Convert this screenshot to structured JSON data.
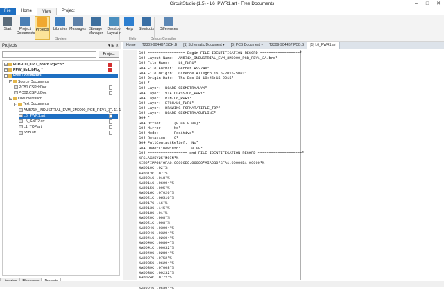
{
  "window": {
    "title": "CircuitStudio (1.5) - L6_PWR1.art - Free Documents"
  },
  "ribbon_tabs": [
    "File",
    "Home",
    "View",
    "Project"
  ],
  "ribbon_buttons": [
    {
      "label": "Start",
      "icon": "start-icon"
    },
    {
      "label": "Project\nDocuments",
      "icon": "project-documents-icon"
    },
    {
      "label": "Projects",
      "icon": "projects-icon"
    },
    {
      "label": "Libraries",
      "icon": "libraries-icon"
    },
    {
      "label": "Messages",
      "icon": "messages-icon"
    },
    {
      "label": "Storage\nManager",
      "icon": "storage-manager-icon"
    },
    {
      "label": "Desktop\nLayout ▾",
      "icon": "desktop-layout-icon"
    },
    {
      "label": "Help",
      "icon": "help-icon"
    },
    {
      "label": "Shortcuts",
      "icon": "shortcuts-icon"
    },
    {
      "label": "Differences",
      "icon": "differences-icon"
    }
  ],
  "ribbon_groups": {
    "system": "System",
    "help": "Help",
    "design_compiler": "Design Compiler"
  },
  "projects_panel": {
    "title": "Projects",
    "controls": "▾ ⊞ ✕",
    "project_button": "Project",
    "tree": [
      {
        "label": "FCP-100_CPU_board.PrjPcb *",
        "level": 0,
        "exp": "+",
        "bold": true,
        "pdf": true
      },
      {
        "label": "PFW_lib.LibPkg *",
        "level": 0,
        "exp": "+",
        "bold": true,
        "pdf": true
      },
      {
        "label": "Free Documents",
        "level": 0,
        "exp": "−",
        "bold": true,
        "selected": true
      },
      {
        "label": "Source Documents",
        "level": 1,
        "exp": "−"
      },
      {
        "label": "PCB1.CSPcbDoc",
        "level": 2,
        "doc": true
      },
      {
        "label": "PCB2.CSPcbDoc",
        "level": 2,
        "doc": true
      },
      {
        "label": "Documentation",
        "level": 1,
        "exp": "−"
      },
      {
        "label": "Text Documents",
        "level": 2,
        "exp": "−"
      },
      {
        "label": "AM571X_INDUSTRIAL_EVM_3M0000_PCB_REV1_3A-11-1",
        "level": 3,
        "doc": true
      },
      {
        "label": "L6_PWR1.art",
        "level": 3,
        "doc": true,
        "selected": true
      },
      {
        "label": "L5_GND2.art",
        "level": 3,
        "doc": true
      },
      {
        "label": "L1_TOP.art",
        "level": 3,
        "doc": true
      },
      {
        "label": "SSB.art",
        "level": 3,
        "doc": true
      }
    ],
    "bottom_tabs": [
      "Libraries",
      "Messages",
      "Projects"
    ]
  },
  "doc_tabs": [
    "Home",
    "T2309-9044B7.SCH.B",
    "[1] Schematic Document ▾",
    "[6] PCB Document ▾",
    "T2309-9044B7.PCB.B",
    "[5] L6_PWR1.art"
  ],
  "code_lines": [
    "G04 ================= Begin FILE IDENTIFICATION RECORD ==================*",
    "G04 Layout Name:  AM571X_INDUSTRIAL_EVM_3M0000_PCB_REV1_3A.brd*",
    "G04 File Name:    L6_PWR1*",
    "G04 File Format:  Gerber RS274X*",
    "G04 File Origin:  Cadence Allegro 16.6-2015-S062*",
    "G04 Origin Date:  Thu Dec 31 19:46:15 2015*",
    "G04 *",
    "G04 Layer:  BOARD GEOMETRY/LYX*",
    "G04 Layer:  VIA CLASS/L6_PWR1*",
    "G04 Layer:  PIN/L6_PWR1*",
    "G04 Layer:  ETCH/L6_PWR1*",
    "G04 Layer:  DRAWING FORMAT/TITLE_TOP*",
    "G04 Layer:  BOARD GEOMETRY/OUTLINE*",
    "G04 *",
    "G04 Offset:     (0.00 0.00)*",
    "G04 Mirror:     No*",
    "G04 Mode:       Positive*",
    "G04 Rotation:   0*",
    "G04 FullContactRelief:  No*",
    "G04 UndefLineWidth:     0.00*",
    "G04 ================== end FILE IDENTIFICATION RECORD ====================*",
    "%FSLAX25Y25*MOIN*%",
    "%IR0*IPPOS*OFA0.00000B0.00000*MIA0B0*SFA1.00000B1.00000*%",
    "%ADD10C,.02*%",
    "%ADD13C,.07*%",
    "%ADD21C,.018*%",
    "%ADD11C,.06004*%",
    "%ADD15C,.095*%",
    "%ADD16C,.07026*%",
    "%ADD21C,.06516*%",
    "%ADD17C,.16*%",
    "%ADD13C,.145*%",
    "%ADD18C,.01*%",
    "%ADD20C,.008*%",
    "%ADD21C,.008*%",
    "%ADD24C,.03004*%",
    "%ADD24C,.03204*%",
    "%ADD41C,.02604*%",
    "%ADD40C,.00804*%",
    "%ADD41C,.00032*%",
    "%ADD40C,.02804*%",
    "%ADD27C,.0752*%",
    "%ADD35C,.06204*%",
    "%ADD39C,.07008*%",
    "%ADD38C,.00232*%",
    "%ADD24C,.0772*%",
    "%ADD38C,.07208*%",
    "%ADD24C,.06304*%"
  ]
}
